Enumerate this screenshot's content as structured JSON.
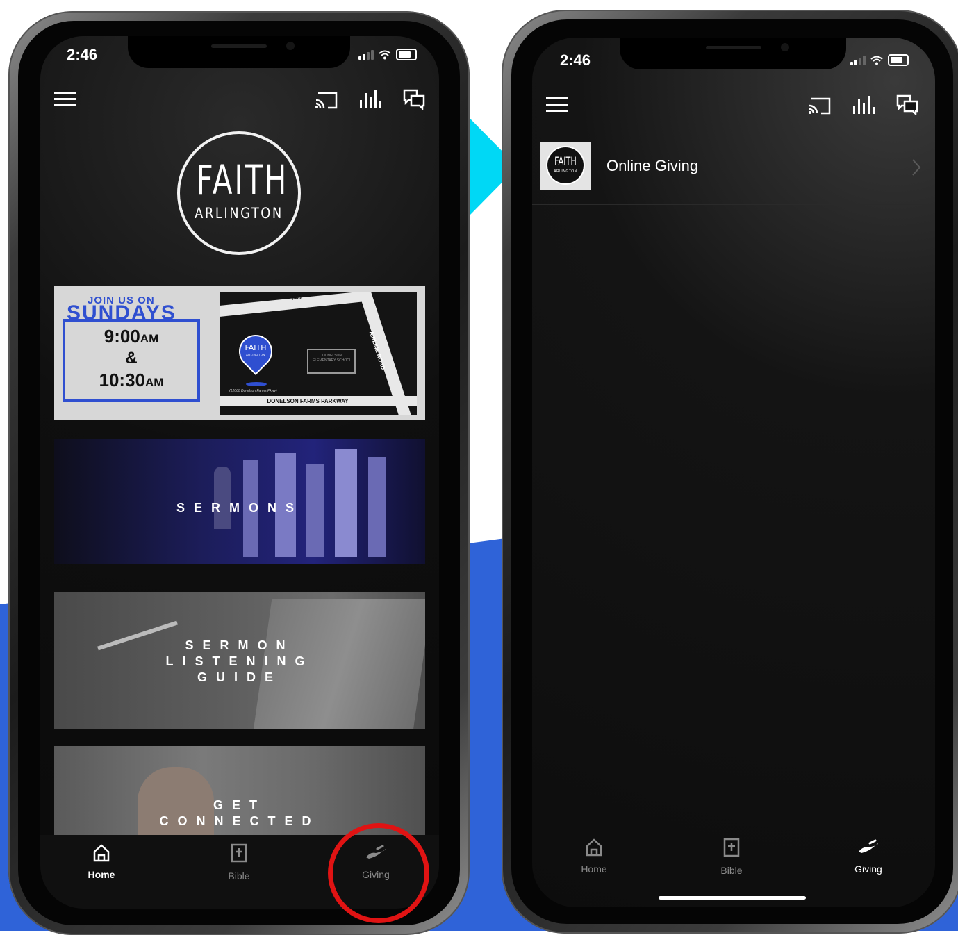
{
  "colors": {
    "accent_blue": "#2f63d8",
    "arrow_cyan": "#00d8f5",
    "highlight_red": "#e01313"
  },
  "status_bar": {
    "time": "2:46"
  },
  "left_screen": {
    "header_icons": [
      "menu-icon",
      "cast-icon",
      "audio-bars-icon",
      "chat-icon"
    ],
    "logo": {
      "top": "FAITH",
      "bottom": "ARLINGTON"
    },
    "service_card": {
      "join_line": "JOIN US ON",
      "day": "SUNDAYS",
      "time1": "9:00",
      "time1_suffix": "AM",
      "amp": "&",
      "time2": "10:30",
      "time2_suffix": "AM",
      "map": {
        "road_top": "I-40",
        "road_side": "AIRLINE ROAD",
        "pin_text": "FAITH",
        "pin_subtext": "ARLINGTON",
        "school": "DONELSON ELEMENTARY SCHOOL",
        "address_note": "(12060 Donelson Farms Pkwy)",
        "parkway": "DONELSON FARMS PARKWAY"
      }
    },
    "tiles": [
      {
        "label": "SERMONS"
      },
      {
        "label_lines": [
          "SERMON",
          "LISTENING",
          "GUIDE"
        ]
      },
      {
        "label_lines": [
          "GET",
          "CONNECTED"
        ]
      }
    ]
  },
  "right_screen": {
    "list": [
      {
        "title": "Online Giving",
        "thumb_text": "FAITH",
        "thumb_subtext": "ARLINGTON"
      }
    ]
  },
  "tabs": [
    {
      "label": "Home",
      "icon": "home-icon"
    },
    {
      "label": "Bible",
      "icon": "bible-icon"
    },
    {
      "label": "Giving",
      "icon": "giving-hand-icon"
    }
  ],
  "left_active_tab": "Home",
  "right_active_tab": "Giving"
}
